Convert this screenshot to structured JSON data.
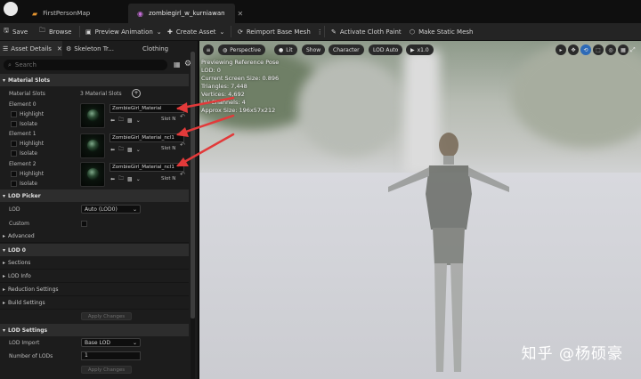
{
  "tabs": [
    {
      "label": "FirstPersonMap",
      "icon": "map-icon"
    },
    {
      "label": "zombiegirl_w_kurniawan",
      "icon": "skeletal-mesh-icon",
      "active": true
    }
  ],
  "toolbar": {
    "save": "Save",
    "browse": "Browse",
    "preview_animation": "Preview Animation",
    "create_asset": "Create Asset",
    "reimport": "Reimport Base Mesh",
    "activate_cloth": "Activate Cloth Paint",
    "make_static": "Make Static Mesh"
  },
  "panel_tabs": {
    "asset_details": "Asset Details",
    "skeleton_tree": "Skeleton Tr...",
    "clothing": "Clothing"
  },
  "search": {
    "placeholder": "Search"
  },
  "material_slots": {
    "header": "Material Slots",
    "label": "Material Slots",
    "count": "3 Material Slots",
    "elements": [
      {
        "label": "Element 0",
        "material": "ZombieGirl_Material",
        "slot": "Slot N"
      },
      {
        "label": "Element 1",
        "material": "ZombieGirl_Material_ncl1",
        "slot": "Slot N"
      },
      {
        "label": "Element 2",
        "material": "ZombieGirl_Material_ncl1",
        "slot": "Slot N"
      }
    ],
    "highlight": "Highlight",
    "isolate": "Isolate"
  },
  "lod_picker": {
    "header": "LOD Picker",
    "lod_label": "LOD",
    "lod_value": "Auto (LOD0)",
    "custom": "Custom",
    "advanced": "Advanced"
  },
  "lod0": {
    "header": "LOD 0",
    "items": [
      "Sections",
      "LOD Info",
      "Reduction Settings",
      "Build Settings"
    ],
    "apply": "Apply Changes"
  },
  "lod_settings": {
    "header": "LOD Settings",
    "import_label": "LOD Import",
    "import_value": "Base LOD",
    "num_label": "Number of LODs",
    "num_value": "1",
    "apply": "Apply Changes"
  },
  "viewport": {
    "perspective": "Perspective",
    "lit": "Lit",
    "show": "Show",
    "character": "Character",
    "lod_auto": "LOD Auto",
    "speed": "x1.0",
    "stats": [
      "Previewing Reference Pose",
      "LOD: 0",
      "Current Screen Size: 0.896",
      "Triangles: 7,448",
      "Vertices: 4,692",
      "UV Channels: 4",
      "Approx Size: 196x57x212"
    ],
    "watermark": "知乎 @杨硕豪"
  },
  "colors": {
    "accent": "#d4d4d4",
    "annotation": "#e23a3a"
  }
}
